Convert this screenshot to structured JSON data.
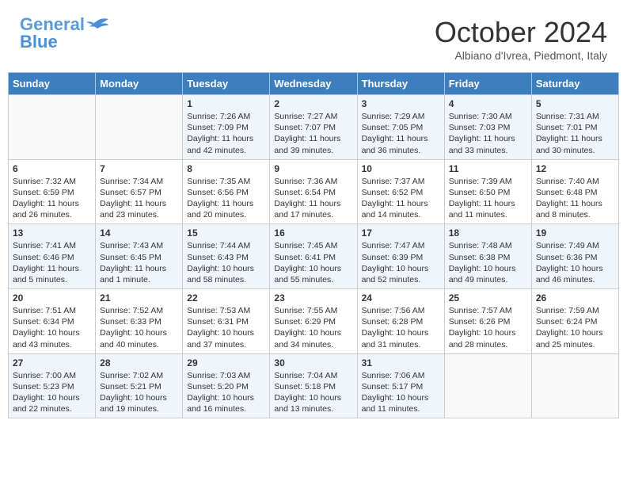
{
  "header": {
    "logo_line1": "General",
    "logo_line2": "Blue",
    "month_title": "October 2024",
    "subtitle": "Albiano d'Ivrea, Piedmont, Italy"
  },
  "days_of_week": [
    "Sunday",
    "Monday",
    "Tuesday",
    "Wednesday",
    "Thursday",
    "Friday",
    "Saturday"
  ],
  "weeks": [
    [
      {
        "day": "",
        "data": ""
      },
      {
        "day": "",
        "data": ""
      },
      {
        "day": "1",
        "data": "Sunrise: 7:26 AM\nSunset: 7:09 PM\nDaylight: 11 hours and 42 minutes."
      },
      {
        "day": "2",
        "data": "Sunrise: 7:27 AM\nSunset: 7:07 PM\nDaylight: 11 hours and 39 minutes."
      },
      {
        "day": "3",
        "data": "Sunrise: 7:29 AM\nSunset: 7:05 PM\nDaylight: 11 hours and 36 minutes."
      },
      {
        "day": "4",
        "data": "Sunrise: 7:30 AM\nSunset: 7:03 PM\nDaylight: 11 hours and 33 minutes."
      },
      {
        "day": "5",
        "data": "Sunrise: 7:31 AM\nSunset: 7:01 PM\nDaylight: 11 hours and 30 minutes."
      }
    ],
    [
      {
        "day": "6",
        "data": "Sunrise: 7:32 AM\nSunset: 6:59 PM\nDaylight: 11 hours and 26 minutes."
      },
      {
        "day": "7",
        "data": "Sunrise: 7:34 AM\nSunset: 6:57 PM\nDaylight: 11 hours and 23 minutes."
      },
      {
        "day": "8",
        "data": "Sunrise: 7:35 AM\nSunset: 6:56 PM\nDaylight: 11 hours and 20 minutes."
      },
      {
        "day": "9",
        "data": "Sunrise: 7:36 AM\nSunset: 6:54 PM\nDaylight: 11 hours and 17 minutes."
      },
      {
        "day": "10",
        "data": "Sunrise: 7:37 AM\nSunset: 6:52 PM\nDaylight: 11 hours and 14 minutes."
      },
      {
        "day": "11",
        "data": "Sunrise: 7:39 AM\nSunset: 6:50 PM\nDaylight: 11 hours and 11 minutes."
      },
      {
        "day": "12",
        "data": "Sunrise: 7:40 AM\nSunset: 6:48 PM\nDaylight: 11 hours and 8 minutes."
      }
    ],
    [
      {
        "day": "13",
        "data": "Sunrise: 7:41 AM\nSunset: 6:46 PM\nDaylight: 11 hours and 5 minutes."
      },
      {
        "day": "14",
        "data": "Sunrise: 7:43 AM\nSunset: 6:45 PM\nDaylight: 11 hours and 1 minute."
      },
      {
        "day": "15",
        "data": "Sunrise: 7:44 AM\nSunset: 6:43 PM\nDaylight: 10 hours and 58 minutes."
      },
      {
        "day": "16",
        "data": "Sunrise: 7:45 AM\nSunset: 6:41 PM\nDaylight: 10 hours and 55 minutes."
      },
      {
        "day": "17",
        "data": "Sunrise: 7:47 AM\nSunset: 6:39 PM\nDaylight: 10 hours and 52 minutes."
      },
      {
        "day": "18",
        "data": "Sunrise: 7:48 AM\nSunset: 6:38 PM\nDaylight: 10 hours and 49 minutes."
      },
      {
        "day": "19",
        "data": "Sunrise: 7:49 AM\nSunset: 6:36 PM\nDaylight: 10 hours and 46 minutes."
      }
    ],
    [
      {
        "day": "20",
        "data": "Sunrise: 7:51 AM\nSunset: 6:34 PM\nDaylight: 10 hours and 43 minutes."
      },
      {
        "day": "21",
        "data": "Sunrise: 7:52 AM\nSunset: 6:33 PM\nDaylight: 10 hours and 40 minutes."
      },
      {
        "day": "22",
        "data": "Sunrise: 7:53 AM\nSunset: 6:31 PM\nDaylight: 10 hours and 37 minutes."
      },
      {
        "day": "23",
        "data": "Sunrise: 7:55 AM\nSunset: 6:29 PM\nDaylight: 10 hours and 34 minutes."
      },
      {
        "day": "24",
        "data": "Sunrise: 7:56 AM\nSunset: 6:28 PM\nDaylight: 10 hours and 31 minutes."
      },
      {
        "day": "25",
        "data": "Sunrise: 7:57 AM\nSunset: 6:26 PM\nDaylight: 10 hours and 28 minutes."
      },
      {
        "day": "26",
        "data": "Sunrise: 7:59 AM\nSunset: 6:24 PM\nDaylight: 10 hours and 25 minutes."
      }
    ],
    [
      {
        "day": "27",
        "data": "Sunrise: 7:00 AM\nSunset: 5:23 PM\nDaylight: 10 hours and 22 minutes."
      },
      {
        "day": "28",
        "data": "Sunrise: 7:02 AM\nSunset: 5:21 PM\nDaylight: 10 hours and 19 minutes."
      },
      {
        "day": "29",
        "data": "Sunrise: 7:03 AM\nSunset: 5:20 PM\nDaylight: 10 hours and 16 minutes."
      },
      {
        "day": "30",
        "data": "Sunrise: 7:04 AM\nSunset: 5:18 PM\nDaylight: 10 hours and 13 minutes."
      },
      {
        "day": "31",
        "data": "Sunrise: 7:06 AM\nSunset: 5:17 PM\nDaylight: 10 hours and 11 minutes."
      },
      {
        "day": "",
        "data": ""
      },
      {
        "day": "",
        "data": ""
      }
    ]
  ]
}
